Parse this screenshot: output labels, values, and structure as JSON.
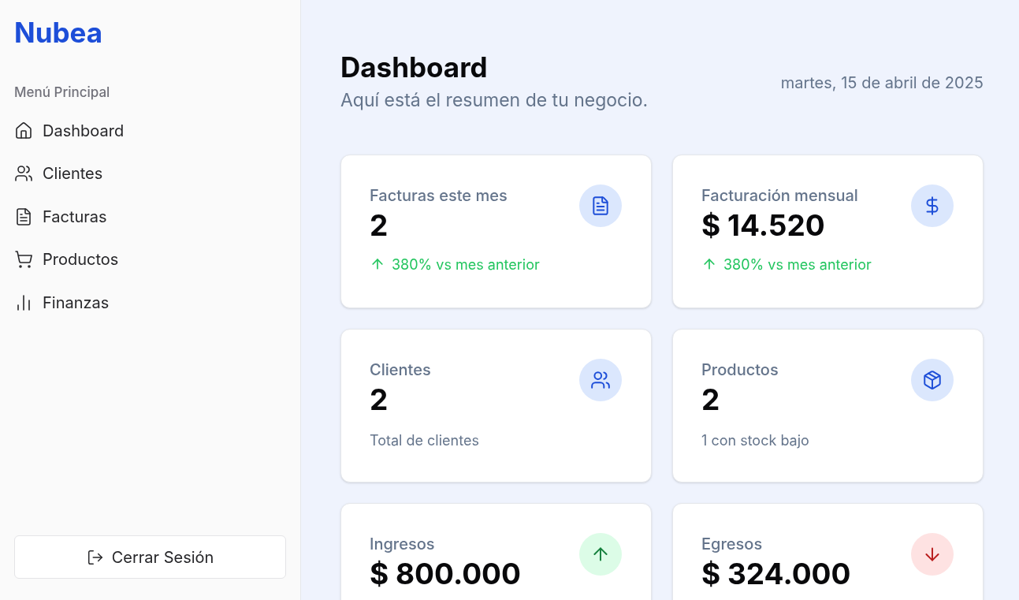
{
  "sidebar": {
    "logo": "Nubea",
    "section_title": "Menú Principal",
    "items": [
      {
        "label": "Dashboard"
      },
      {
        "label": "Clientes"
      },
      {
        "label": "Facturas"
      },
      {
        "label": "Productos"
      },
      {
        "label": "Finanzas"
      }
    ],
    "logout": "Cerrar Sesión"
  },
  "header": {
    "title": "Dashboard",
    "subtitle": "Aquí está el resumen de tu negocio.",
    "date": "martes, 15 de abril de 2025"
  },
  "cards": [
    {
      "title": "Facturas este mes",
      "value": "2",
      "kind": "trend",
      "note": "380% vs mes anterior",
      "color": "#dbe7fd"
    },
    {
      "title": "Facturación mensual",
      "value": "$ 14.520",
      "kind": "trend",
      "note": "380% vs mes anterior",
      "color": "#dbe7fd"
    },
    {
      "title": "Clientes",
      "value": "2",
      "kind": "note",
      "note": "Total de clientes",
      "color": "#dbe7fd"
    },
    {
      "title": "Productos",
      "value": "2",
      "kind": "note",
      "note": "1 con stock bajo",
      "color": "#dbe7fd"
    },
    {
      "title": "Ingresos",
      "value": "$ 800.000",
      "kind": "income",
      "color": "#dcfce7"
    },
    {
      "title": "Egresos",
      "value": "$ 324.000",
      "kind": "expense",
      "color": "#fee2e2"
    }
  ]
}
